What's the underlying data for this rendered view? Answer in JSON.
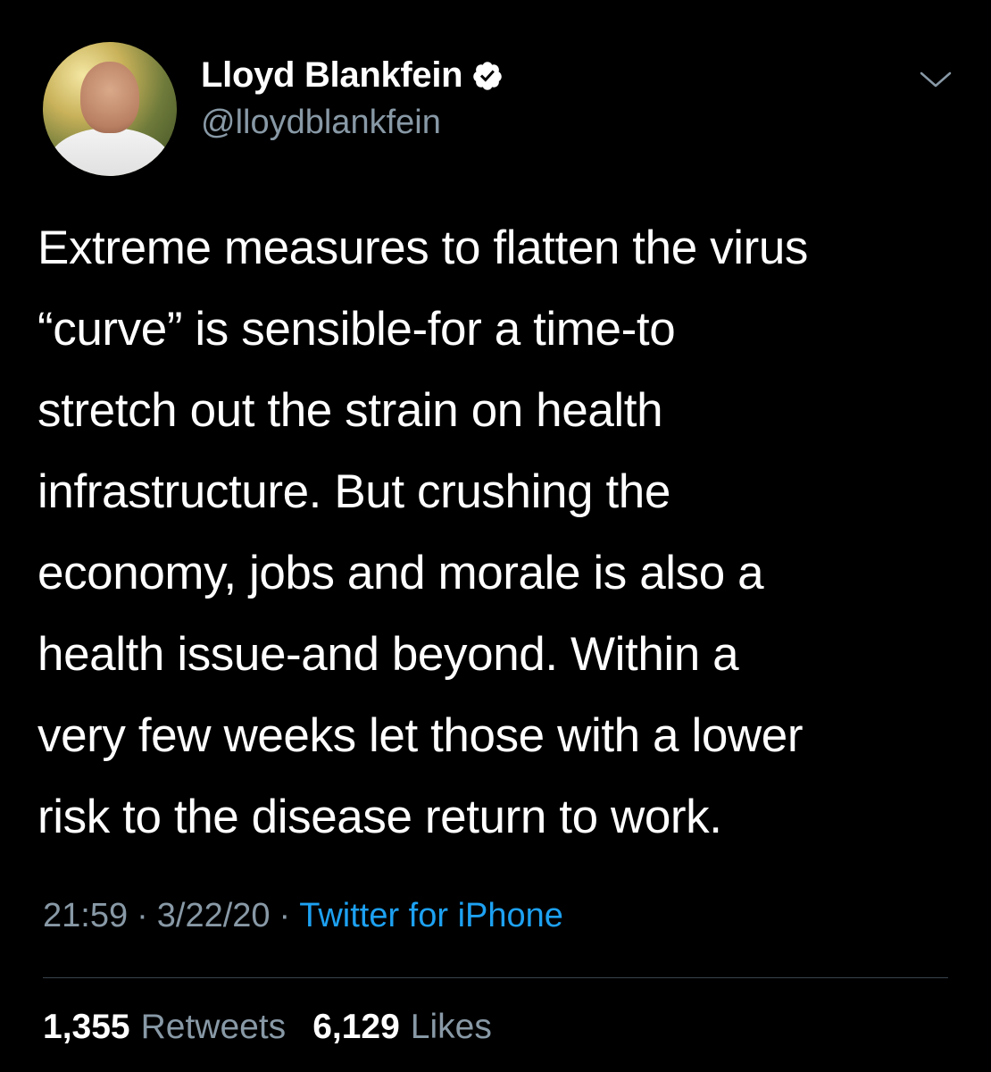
{
  "author": {
    "name": "Lloyd Blankfein",
    "handle": "@lloydblankfein",
    "verified": true,
    "avatar_icon": "profile-photo"
  },
  "tweet": {
    "lines": [
      "Extreme measures to flatten the virus",
      "“curve” is sensible-for a time-to",
      "stretch out the strain on health",
      "infrastructure. But crushing the",
      "economy, jobs and morale is also a",
      "health issue-and beyond. Within a",
      "very few weeks let those with a lower",
      "risk to the disease return to work."
    ]
  },
  "meta": {
    "time": "21:59",
    "separator": "·",
    "date": "3/22/20",
    "source": "Twitter for iPhone"
  },
  "stats": {
    "retweets_count": "1,355",
    "retweets_label": "Retweets",
    "likes_count": "6,129",
    "likes_label": "Likes"
  },
  "colors": {
    "background": "#000000",
    "text_primary": "#ffffff",
    "text_secondary": "#8899a6",
    "link": "#1da1f2",
    "divider": "#38444d"
  },
  "icons": {
    "verified": "verified-badge-icon",
    "menu": "chevron-down-icon"
  }
}
